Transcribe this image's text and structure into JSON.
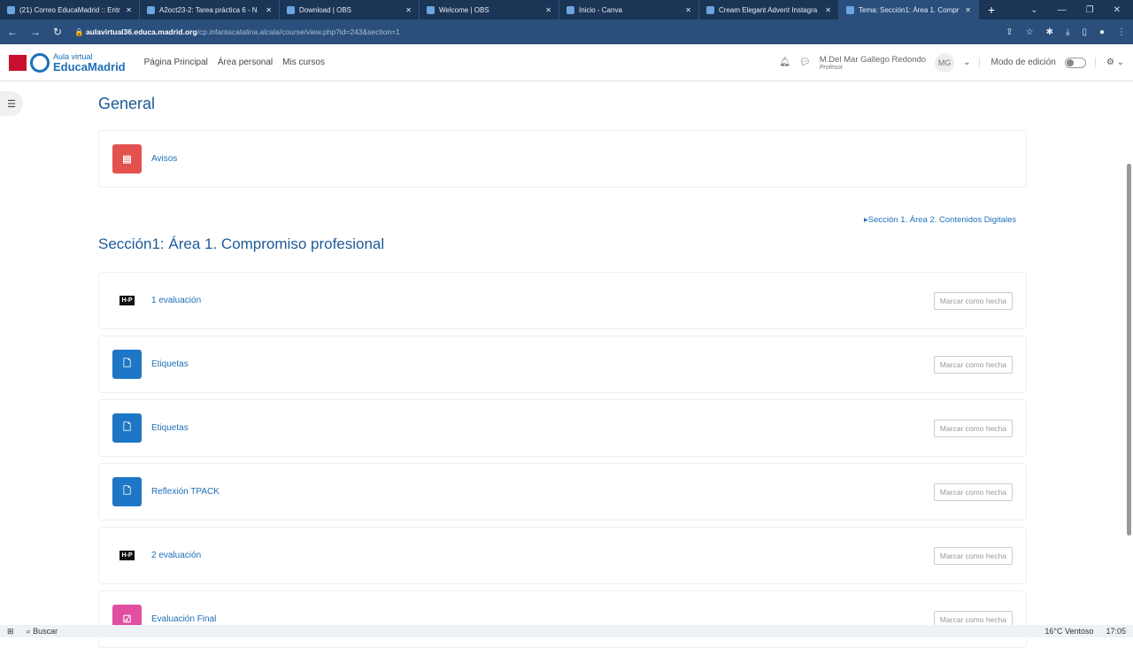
{
  "browser": {
    "tabs": [
      {
        "title": "(21) Correo EducaMadrid :: Entr"
      },
      {
        "title": "A2oct23-2: Tarea práctica 6 - N"
      },
      {
        "title": "Download | OBS"
      },
      {
        "title": "Welcome | OBS"
      },
      {
        "title": "Inicio - Canva"
      },
      {
        "title": "Cream Elegant Advent Instagra"
      },
      {
        "title": "Tema: Sección1: Área 1. Compr"
      }
    ],
    "url_host": "aulavirtual36.educa.madrid.org",
    "url_path": "/cp.infantacatalina.alcala/course/view.php?id=243&section=1"
  },
  "header": {
    "logo_top": "Aula virtual",
    "logo_main": "EducaMadrid",
    "nav": [
      "Página Principal",
      "Área personal",
      "Mis cursos"
    ],
    "user_name": "M.Del Mar Gallego Redondo",
    "user_role": "Profesor",
    "initials": "MG",
    "edit_mode": "Modo de edición"
  },
  "general": {
    "title": "General",
    "items": [
      {
        "label": "Avisos"
      }
    ]
  },
  "section": {
    "next_link": "▸Sección 1. Área 2. Contenidos Digitales",
    "title": "Sección1: Área 1. Compromiso profesional",
    "mark_label": "Marcar como hecha",
    "items": [
      {
        "label": "1 evaluación",
        "type": "h5p"
      },
      {
        "label": "Etiquetas",
        "type": "page"
      },
      {
        "label": "Etiquetas",
        "type": "page"
      },
      {
        "label": "Reflexión TPACK",
        "type": "page"
      },
      {
        "label": "2 evaluación",
        "type": "h5p"
      },
      {
        "label": "Evaluación Final",
        "type": "assign"
      }
    ]
  },
  "taskbar": {
    "search": "Buscar",
    "weather": "16°C  Ventoso",
    "time": "17:05"
  }
}
